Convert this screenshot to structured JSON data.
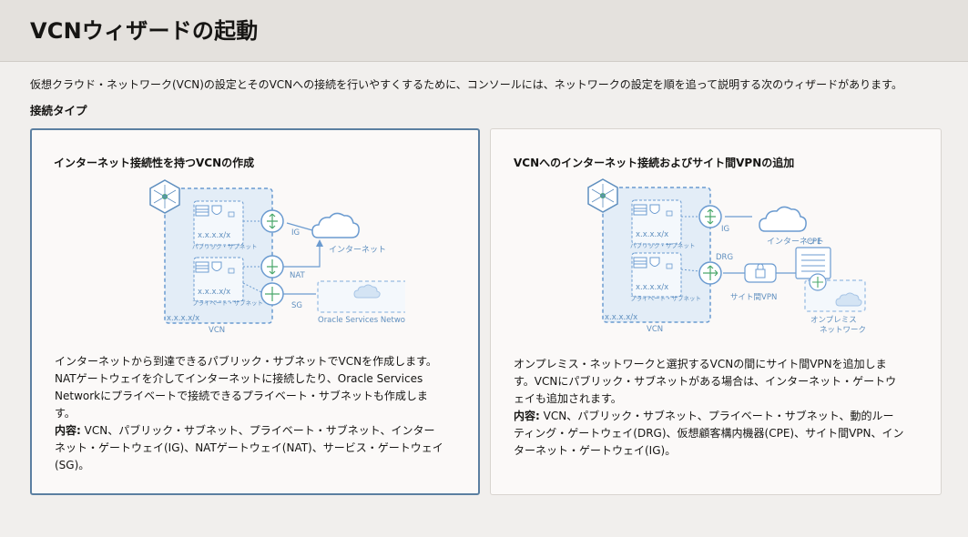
{
  "page": {
    "title": "VCNウィザードの起動",
    "intro": "仮想クラウド・ネットワーク(VCN)の設定とそのVCNへの接続を行いやすくするために、コンソールには、ネットワークの設定を順を追って説明する次のウィザードがあります。",
    "section_label": "接続タイプ"
  },
  "cards": [
    {
      "title": "インターネット接続性を持つVCNの作成",
      "desc_line1": "インターネットから到達できるパブリック・サブネットでVCNを作成します。",
      "desc_line2": "NATゲートウェイを介してインターネットに接続したり、Oracle Services",
      "desc_line3": "Networkにプライベートで接続できるプライベート・サブネットも作成しま",
      "desc_line4": "す。",
      "contents_label": "内容:",
      "contents_line1": " VCN、パブリック・サブネット、プライベート・サブネット、インター",
      "contents_line2": "ネット・ゲートウェイ(IG)、NATゲートウェイ(NAT)、サービス・ゲートウェイ",
      "contents_line3": "(SG)。",
      "diagram": {
        "cidr_public": "x.x.x.x/x",
        "public_subnet": "パブリック・サブネット",
        "cidr_private": "x.x.x.x/x",
        "private_subnet": "プライベート・サブネット",
        "cidr_vcn": "x.x.x.x/x",
        "vcn": "VCN",
        "ig": "IG",
        "nat": "NAT",
        "sg": "SG",
        "internet": "インターネット",
        "osn": "Oracle Services Network"
      }
    },
    {
      "title": "VCNへのインターネット接続およびサイト間VPNの追加",
      "desc_line1": "オンプレミス・ネットワークと選択するVCNの間にサイト間VPNを追加しま",
      "desc_line2": "す。VCNにパブリック・サブネットがある場合は、インターネット・ゲートウ",
      "desc_line3": "ェイも追加されます。",
      "contents_label": "内容:",
      "contents_line1": " VCN、パブリック・サブネット、プライベート・サブネット、動的ルー",
      "contents_line2": "ティング・ゲートウェイ(DRG)、仮想顧客構内機器(CPE)、サイト間VPN、イン",
      "contents_line3": "ターネット・ゲートウェイ(IG)。",
      "diagram": {
        "cidr_public": "x.x.x.x/x",
        "public_subnet": "パブリック・サブネット",
        "cidr_private": "x.x.x.x/x",
        "private_subnet": "プライベート・サブネット",
        "cidr_vcn": "x.x.x.x/x",
        "vcn": "VCN",
        "ig": "IG",
        "drg": "DRG",
        "internet": "インターネット",
        "vpn": "サイト間VPN",
        "cpe": "CPE",
        "onprem_line1": "オンプレミス",
        "onprem_line2": "ネットワーク"
      }
    }
  ],
  "colors": {
    "accent_border": "#5b7fa1",
    "diagram_blue": "#5f8fbf",
    "diagram_fill": "#e3edf7"
  }
}
